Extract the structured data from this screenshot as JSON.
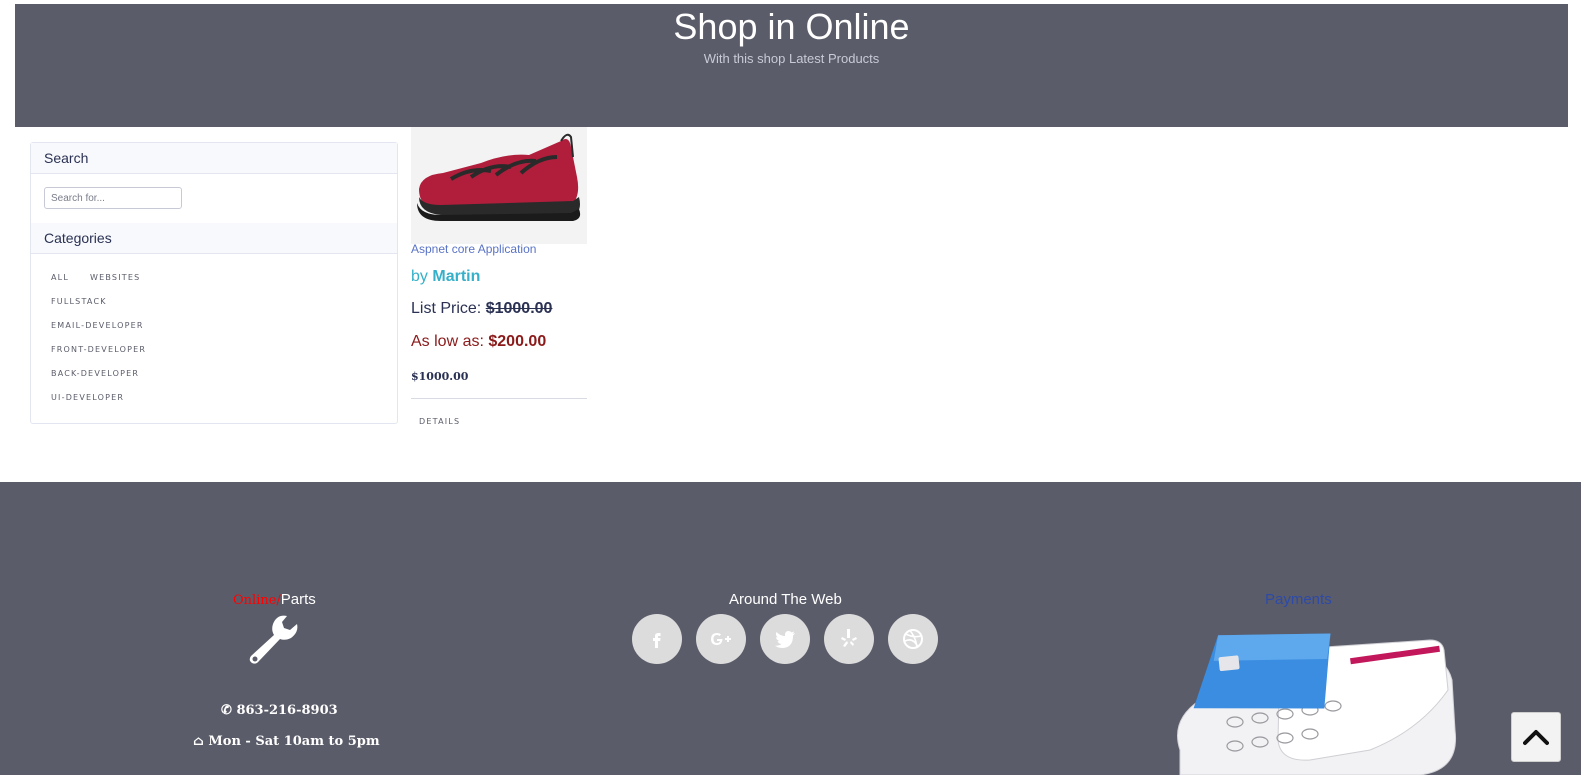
{
  "header": {
    "title": "Shop in Online",
    "subtitle": "With this shop Latest Products"
  },
  "sidebar": {
    "search_heading": "Search",
    "search_placeholder": "Search for...",
    "categories_heading": "Categories",
    "categories": [
      "ALL",
      "WEBSITES",
      "FULLSTACK",
      "EMAIL-DEVELOPER",
      "FRONT-DEVELOPER",
      "BACK-DEVELOPER",
      "UI-DEVELOPER"
    ]
  },
  "product": {
    "title": "Aspnet core Application",
    "by_label": "by",
    "author": "Martin",
    "list_price_label": "List Price:",
    "list_price": "$1000.00",
    "low_price_label": "As low as:",
    "low_price": "$200.00",
    "price": "$1000.00",
    "details_label": "DETAILS",
    "image_colors": {
      "upper": "#b01e3c",
      "sole": "#2a2a2a"
    }
  },
  "footer": {
    "brand_red": "Online/",
    "brand_white": "Parts",
    "brand_icon": "wrench-icon",
    "phone": "863-216-8903",
    "hours": "Mon - Sat 10am to 5pm",
    "around_title": "Around The Web",
    "social_icons": [
      "facebook-icon",
      "google-plus-icon",
      "twitter-icon",
      "yelp-icon",
      "dribbble-icon"
    ],
    "payments_title": "Payments"
  },
  "colors": {
    "header_bg": "#5a5c69",
    "footer_bg": "#5a5c69",
    "accent_link": "#5a73c6",
    "author": "#36b0c9",
    "low_price": "#8b1a1a"
  }
}
